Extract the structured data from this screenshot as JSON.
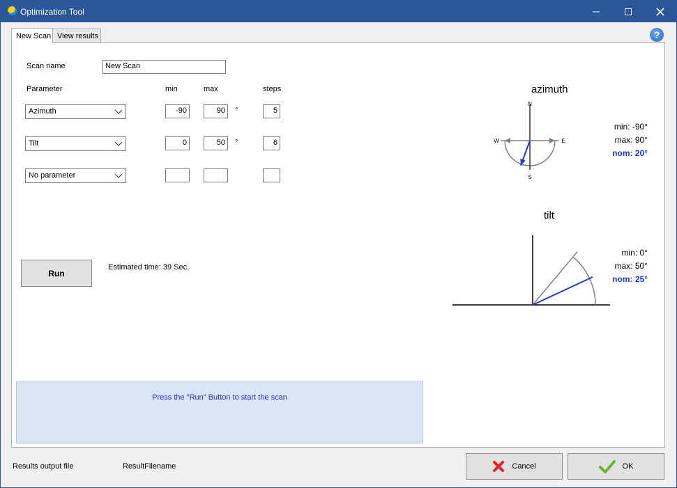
{
  "window": {
    "title": "Optimization Tool"
  },
  "tabs": [
    {
      "label": "New Scan"
    },
    {
      "label": "View results"
    }
  ],
  "help": {
    "glyph": "?"
  },
  "scan": {
    "name_label": "Scan name",
    "name_value": "New Scan"
  },
  "columns": {
    "parameter": "Parameter",
    "min": "min",
    "max": "max",
    "steps": "steps"
  },
  "params": [
    {
      "name": "Azimuth",
      "min": "-90",
      "max": "90",
      "unit": "°",
      "steps": "5"
    },
    {
      "name": "Tilt",
      "min": "0",
      "max": "50",
      "unit": "°",
      "steps": "6"
    },
    {
      "name": "No parameter",
      "min": "",
      "max": "",
      "unit": "",
      "steps": ""
    }
  ],
  "run": {
    "label": "Run",
    "estimate": "Estimated time: 39 Sec."
  },
  "status": {
    "message": "Press the \"Run\" Button to start the scan"
  },
  "azimuth": {
    "title": "azimuth",
    "compass": {
      "n": "N",
      "s": "S",
      "e": "E",
      "w": "W"
    },
    "min_label": "min:",
    "min_value": "-90°",
    "max_label": "max:",
    "max_value": "90°",
    "nom_label": "nom:",
    "nom_value": "20°",
    "nominal_deg": 20,
    "range_deg": [
      -90,
      90
    ]
  },
  "tilt": {
    "title": "tilt",
    "min_label": "min:",
    "min_value": "0°",
    "max_label": "max:",
    "max_value": "50°",
    "nom_label": "nom:",
    "nom_value": "25°",
    "nominal_deg": 25,
    "range_deg": [
      0,
      50
    ]
  },
  "output": {
    "label": "Results output file",
    "filename": "ResultFilename"
  },
  "buttons": {
    "cancel": "Cancel",
    "ok": "OK"
  },
  "colors": {
    "titlebar": "#2b579a",
    "nominal": "#1a3bd1",
    "status_bg": "#d9e5f3",
    "status_text": "#1f33c8",
    "cancel_icon": "#e0202a",
    "ok_icon": "#6ab42d"
  }
}
